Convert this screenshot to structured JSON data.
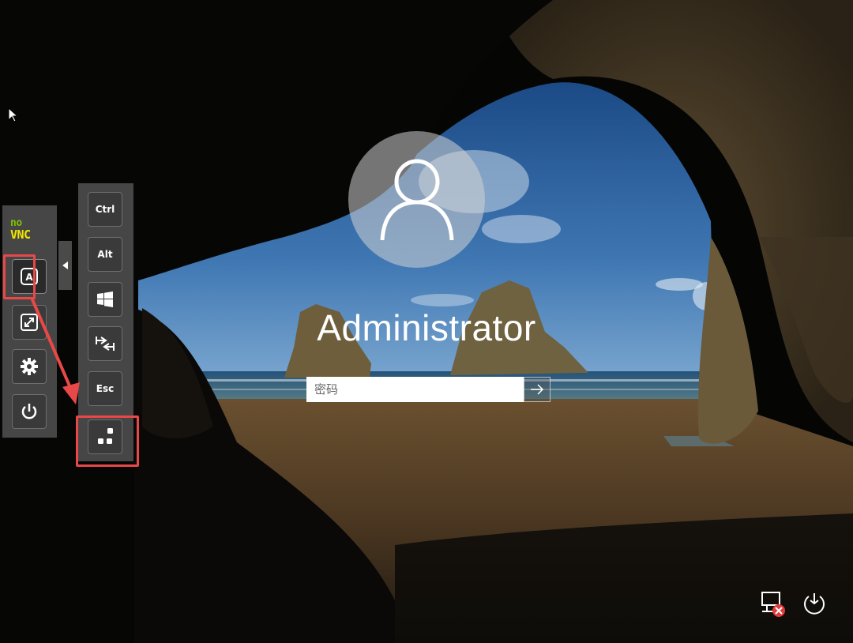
{
  "novnc": {
    "logo_top": "no",
    "logo_bottom": "VNC",
    "logo_colors": {
      "top": "#7fc000",
      "bottom": "#f2e600"
    },
    "toolbar": [
      {
        "name": "keyboard",
        "icon": "keyboard-a-icon",
        "label": "A",
        "selected": true
      },
      {
        "name": "fullscreen",
        "icon": "fullscreen-icon"
      },
      {
        "name": "settings",
        "icon": "gear-icon"
      },
      {
        "name": "power",
        "icon": "power-icon"
      }
    ]
  },
  "extra_keys": {
    "ctrl": "Ctrl",
    "alt": "Alt",
    "windows": "windows-logo-icon",
    "tab": "tab-icon",
    "esc": "Esc",
    "ctrl_alt_del": "ctrl-alt-del-icon"
  },
  "login": {
    "username": "Administrator",
    "password_placeholder": "密码",
    "submit_icon": "arrow-right-icon"
  },
  "system_icons": [
    "network-disconnected-icon",
    "power-options-icon"
  ],
  "colors": {
    "highlight": "#e84848",
    "panel": "#4a4a4a"
  }
}
